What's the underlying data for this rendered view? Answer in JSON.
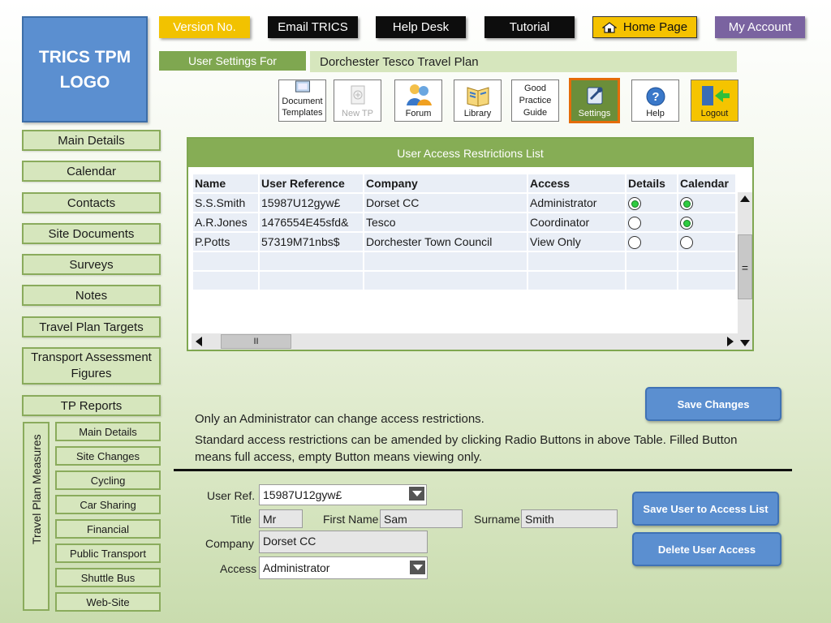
{
  "logo": {
    "line1": "TRICS TPM",
    "line2": "LOGO"
  },
  "topnav": {
    "version": "Version No.",
    "email": "Email TRICS",
    "helpdesk": "Help Desk",
    "tutorial": "Tutorial",
    "home": "Home Page",
    "account": "My Account"
  },
  "settings_bar": {
    "label": "User Settings For",
    "plan": "Dorchester Tesco Travel Plan"
  },
  "toolbar": {
    "document": "Document Templates",
    "new_tp": "New TP",
    "forum": "Forum",
    "library": "Library",
    "good_practice": "Good Practice Guide",
    "settings": "Settings",
    "help": "Help",
    "logout": "Logout"
  },
  "sidebar": {
    "items": [
      "Main Details",
      "Calendar",
      "Contacts",
      "Site Documents",
      "Surveys",
      "Notes",
      "Travel Plan Targets",
      "Transport Assessment Figures",
      "TP Reports"
    ],
    "measures_label": "Travel Plan Measures",
    "measures": [
      "Main Details",
      "Site Changes",
      "Cycling",
      "Car Sharing",
      "Financial",
      "Public Transport",
      "Shuttle Bus",
      "Web-Site"
    ]
  },
  "access_table": {
    "title": "User Access Restrictions List",
    "columns": [
      "Name",
      "User Reference",
      "Company",
      "Access",
      "Details",
      "Calendar"
    ],
    "rows": [
      {
        "name": "S.S.Smith",
        "ref": "15987U12gyw£",
        "company": "Dorset CC",
        "access": "Administrator",
        "details": true,
        "calendar": true
      },
      {
        "name": "A.R.Jones",
        "ref": "1476554E45sfd&",
        "company": "Tesco",
        "access": "Coordinator",
        "details": false,
        "calendar": true
      },
      {
        "name": "P.Potts",
        "ref": "57319M71nbs$",
        "company": "Dorchester Town Council",
        "access": "View Only",
        "details": false,
        "calendar": false
      }
    ],
    "hscroll_thumb": "II",
    "vscroll_thumb": "="
  },
  "buttons": {
    "save_changes": "Save Changes",
    "save_user": "Save User to Access List",
    "delete_user": "Delete User Access"
  },
  "notes": {
    "line1": "Only an Administrator can change access restrictions.",
    "line2": "Standard access restrictions can be amended by clicking Radio Buttons in above Table.  Filled Button means full access, empty Button means viewing only."
  },
  "form": {
    "userref_label": "User Ref.",
    "userref_value": "15987U12gyw£",
    "title_label": "Title",
    "title_value": "Mr",
    "firstname_label": "First Name",
    "firstname_value": "Sam",
    "surname_label": "Surname",
    "surname_value": "Smith",
    "company_label": "Company",
    "company_value": "Dorset CC",
    "access_label": "Access",
    "access_value": "Administrator"
  },
  "colors": {
    "accent_green": "#86ad55",
    "light_green": "#d6e6bd",
    "blue_button": "#5b8fd0",
    "yellow": "#f5c200",
    "purple": "#7a63a0",
    "orange_highlight": "#e46c0a"
  },
  "icons": [
    "document-icon",
    "new-tp-icon",
    "forum-icon",
    "library-icon",
    "settings-icon",
    "help-icon",
    "logout-icon",
    "home-icon"
  ]
}
